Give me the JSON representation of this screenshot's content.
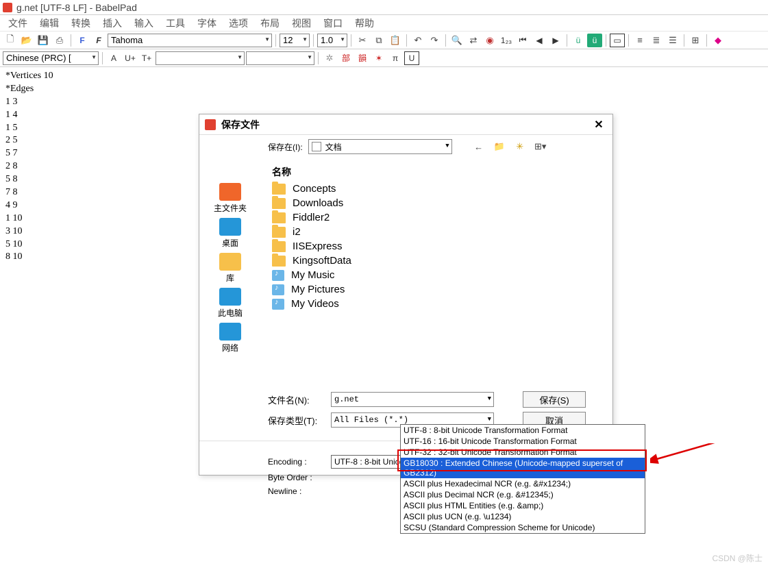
{
  "window": {
    "title": "g.net [UTF-8 LF] - BabelPad"
  },
  "menu": [
    "文件",
    "编辑",
    "转换",
    "插入",
    "输入",
    "工具",
    "字体",
    "选项",
    "布局",
    "视图",
    "窗口",
    "帮助"
  ],
  "toolbar1": {
    "font_name": "Tahoma",
    "font_size": "12",
    "line_spacing": "1.0"
  },
  "toolbar2": {
    "lang": "Chinese (PRC) [",
    "btn_a": "A",
    "btn_uplus": "U+",
    "btn_tplus": "T+"
  },
  "document_lines": [
    "*Vertices 10",
    "*Edges",
    "1 3",
    "1 4",
    "1 5",
    "2 5",
    "5 7",
    "2 8",
    "5 8",
    "7 8",
    "4 9",
    "1 10",
    "3 10",
    "5 10",
    "8 10"
  ],
  "dialog": {
    "title": "保存文件",
    "save_in_label": "保存在(I):",
    "save_in_value": "文档",
    "places": [
      {
        "key": "home",
        "label": "主文件夹",
        "color": "#f0662a"
      },
      {
        "key": "desktop",
        "label": "桌面",
        "color": "#2596d8"
      },
      {
        "key": "library",
        "label": "库",
        "color": "#f7c04a"
      },
      {
        "key": "thispc",
        "label": "此电脑",
        "color": "#2596d8"
      },
      {
        "key": "network",
        "label": "网络",
        "color": "#2596d8"
      }
    ],
    "column_header": "名称",
    "files": [
      {
        "name": "Concepts",
        "type": "folder"
      },
      {
        "name": "Downloads",
        "type": "folder"
      },
      {
        "name": "Fiddler2",
        "type": "folder"
      },
      {
        "name": "i2",
        "type": "folder"
      },
      {
        "name": "IISExpress",
        "type": "folder"
      },
      {
        "name": "KingsoftData",
        "type": "folder"
      },
      {
        "name": "My Music",
        "type": "media"
      },
      {
        "name": "My Pictures",
        "type": "media"
      },
      {
        "name": "My Videos",
        "type": "media"
      }
    ],
    "filename_label": "文件名(N):",
    "filename_value": "g.net",
    "filetype_label": "保存类型(T):",
    "filetype_value": "All Files (*.*)",
    "save_btn": "保存(S)",
    "cancel_btn": "取消",
    "encoding_label": "Encoding :",
    "encoding_value": "UTF-8 : 8-bit Unicode Transformation Format",
    "byteorder_label": "Byte Order :",
    "newline_label": "Newline :",
    "encoding_options": [
      "UTF-8 : 8-bit Unicode Transformation Format",
      "UTF-16 : 16-bit Unicode Transformation Format",
      "UTF-32 : 32-bit Unicode Transformation Format",
      "GB18030 : Extended Chinese (Unicode-mapped superset of GB2312)",
      "ASCII plus Hexadecimal NCR (e.g. &#x1234;)",
      "ASCII plus Decimal NCR (e.g. &#12345;)",
      "ASCII plus HTML Entities (e.g. &amp;)",
      "ASCII plus UCN (e.g. \\u1234)",
      "SCSU (Standard Compression Scheme for Unicode)"
    ],
    "selected_encoding_index": 3
  },
  "watermark": "CSDN @陈士"
}
